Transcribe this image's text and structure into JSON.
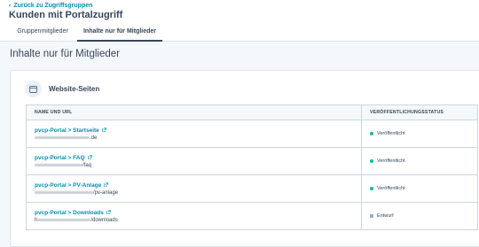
{
  "header": {
    "back_label": "Zurück zu Zugriffsgruppen",
    "title": "Kunden mit Portalzugriff",
    "tabs": [
      {
        "label": "Gruppenmitglieder",
        "active": false
      },
      {
        "label": "Inhalte nur für Mitglieder",
        "active": true
      }
    ]
  },
  "main": {
    "section_title": "Inhalte nur für Mitglieder",
    "card": {
      "title": "Website-Seiten",
      "icon": "browser-window-icon",
      "columns": [
        "NAME UND URL",
        "VERÖFFENTLICHUNGSSTATUS"
      ],
      "rows": [
        {
          "name": "pvcp-Portal > Startseite",
          "url_suffix": ".de",
          "status": "Veröffentlicht",
          "status_color": "#00bda5"
        },
        {
          "name": "pvcp-Portal > FAQ",
          "url_suffix": "/faq",
          "status": "Veröffentlicht",
          "status_color": "#00bda5"
        },
        {
          "name": "pvcp-Portal > PV-Anlage",
          "url_suffix": "/pv-anlage",
          "status": "Veröffentlicht",
          "status_color": "#00bda5"
        },
        {
          "name": "pvcp-Portal > Downloads",
          "url_prefix": "h",
          "url_suffix": "/downloads",
          "status": "Entwurf",
          "status_color": "#99acc2"
        }
      ]
    }
  },
  "colors": {
    "link": "#0091ae",
    "text": "#33475b",
    "published": "#00bda5",
    "draft": "#99acc2"
  }
}
